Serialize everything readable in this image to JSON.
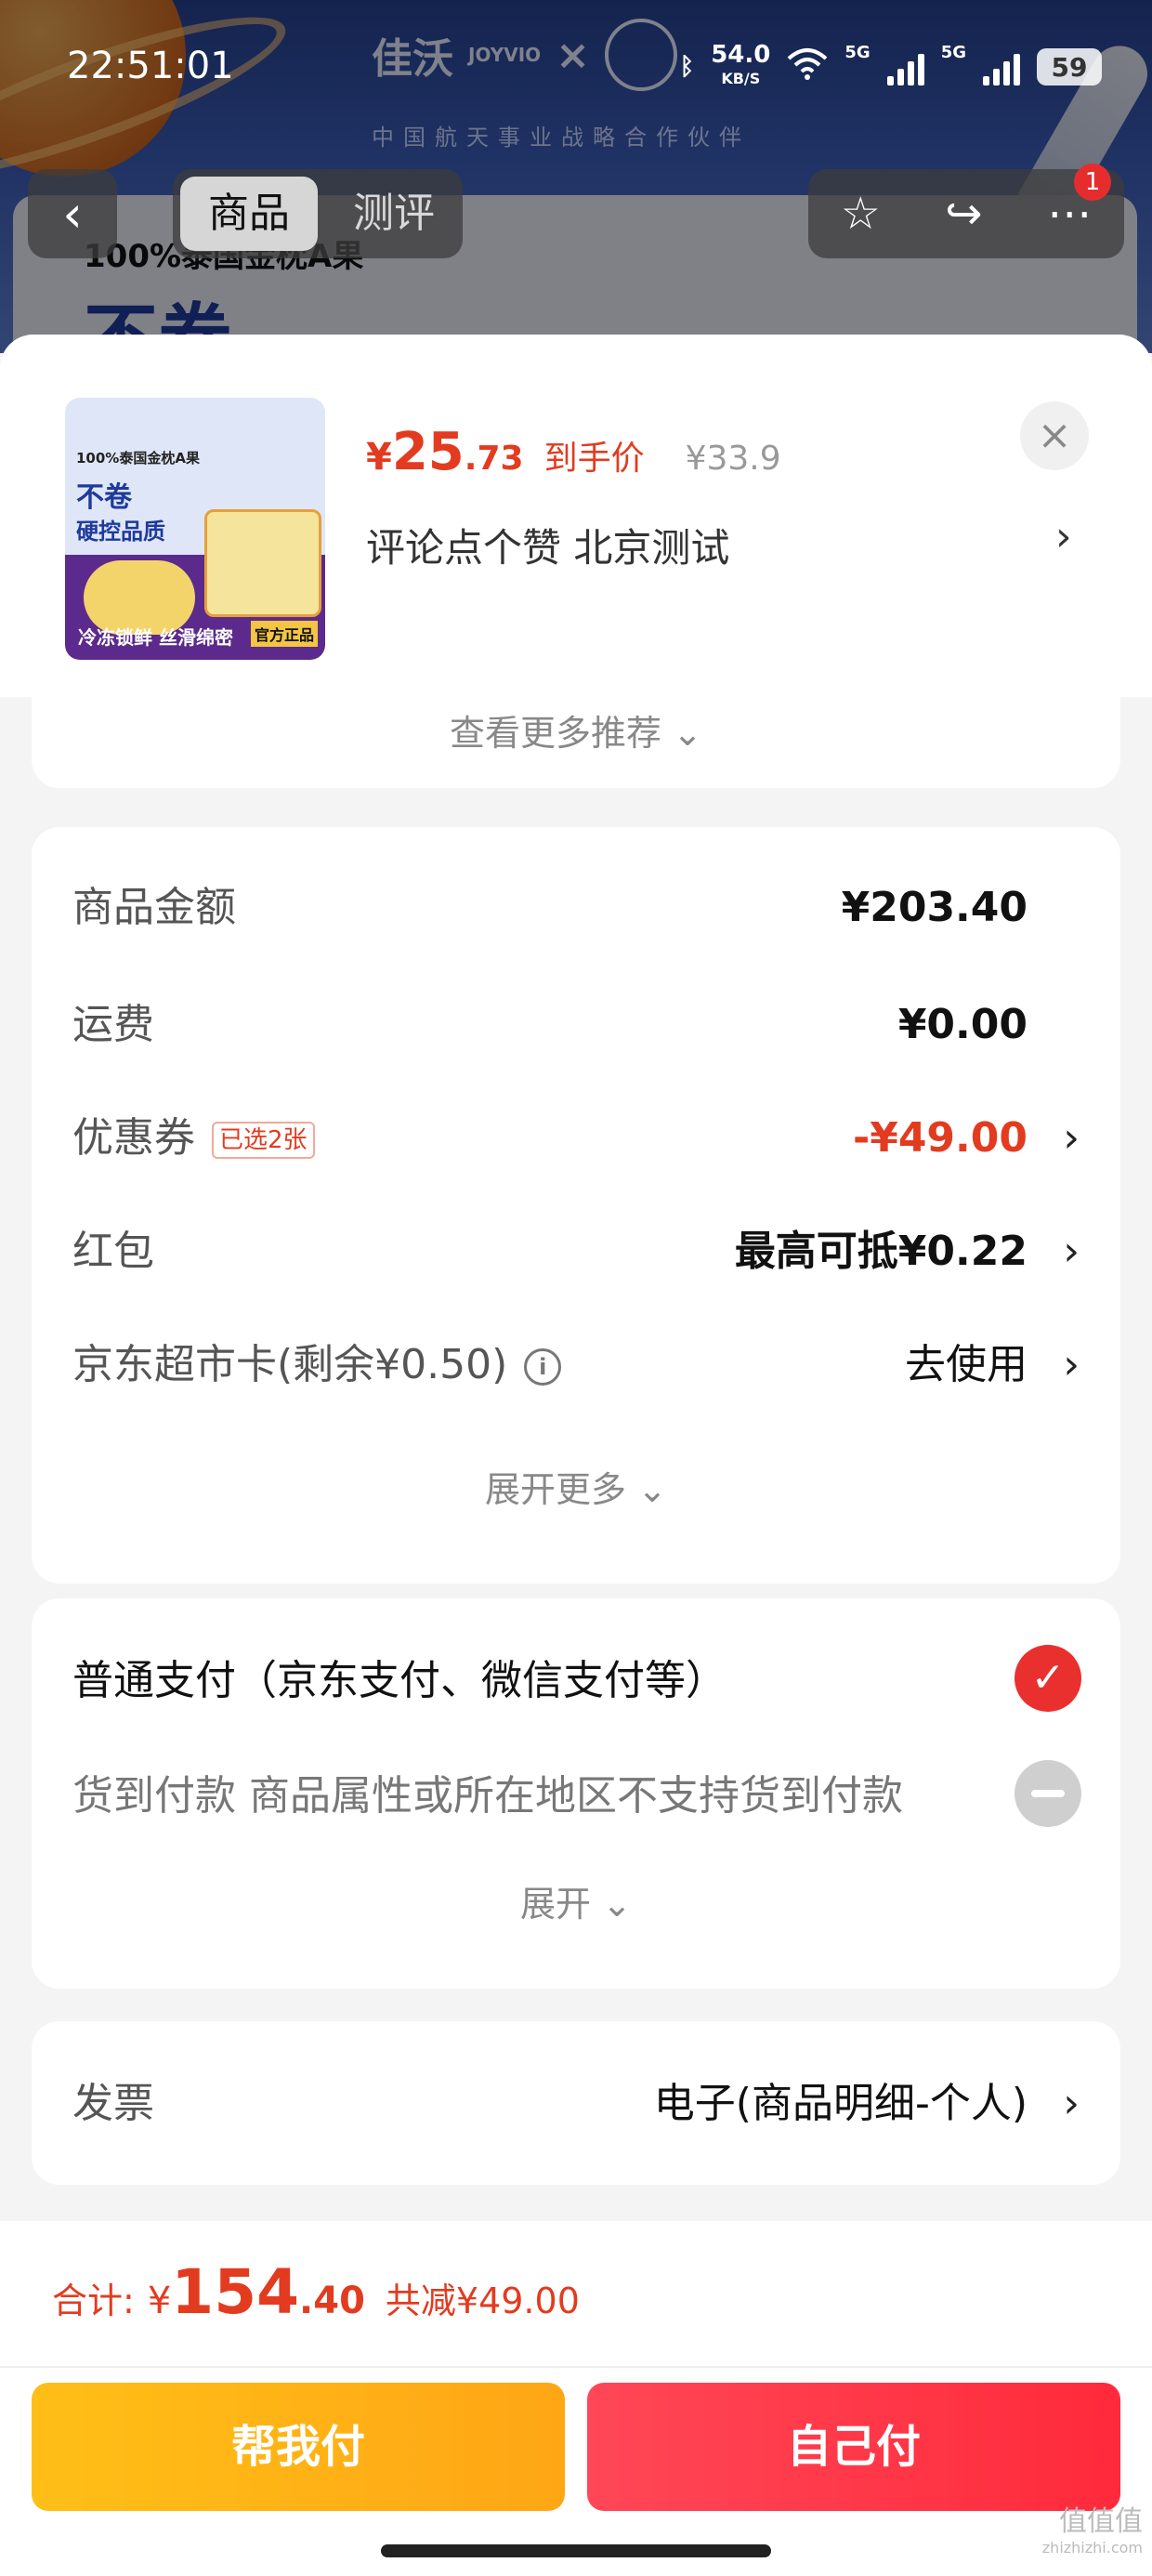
{
  "status_bar": {
    "time": "22:51:01",
    "net_speed": "54.0",
    "net_unit": "KB/S",
    "sim1": "5G",
    "sim2": "5G",
    "battery": "59"
  },
  "background": {
    "brand": "佳沃",
    "brand_en": "JOYVIO",
    "partner_sub": "中国航天事业战略合作伙伴",
    "banner_title": "100%泰国金枕A果",
    "banner_big": "不卷"
  },
  "nav": {
    "tabs": [
      "商品",
      "测评"
    ],
    "active_tab": 0,
    "notification_count": "1"
  },
  "product": {
    "thumb_texts": [
      "100%泰国金枕A果",
      "不卷",
      "硬控品质",
      "冷冻锁鲜 丝滑绵密",
      "官方正品"
    ],
    "price_currency": "¥",
    "price_int": "25",
    "price_dec": ".73",
    "price_label": "到手价",
    "original_price": "¥33.9",
    "review_text": "评论点个赞  北京测试"
  },
  "more_recommend": "查看更多推荐 ⌄",
  "summary": {
    "rows": [
      {
        "label": "商品金额",
        "value": "¥203.40"
      },
      {
        "label": "运费",
        "value": "¥0.00"
      },
      {
        "label": "优惠券",
        "tag": "已选2张",
        "value": "-¥49.00"
      },
      {
        "label": "红包",
        "value": "最高可抵¥0.22"
      },
      {
        "label": "京东超市卡(剩余¥0.50)",
        "value": "去使用"
      }
    ],
    "expand_label": "展开更多 ⌄"
  },
  "payment": {
    "normal_label": "普通支付（京东支付、微信支付等）",
    "cod_label": "货到付款  商品属性或所在地区不支持货到付款",
    "expand_label": "展开 ⌄"
  },
  "invoice": {
    "label": "发票",
    "value": "电子(商品明细-个人)"
  },
  "footer": {
    "total_label": "合计:",
    "total_currency": "¥",
    "total_int": "154",
    "total_dec": ".40",
    "saved": "共减¥49.00",
    "help_pay": "帮我付",
    "self_pay": "自己付"
  },
  "watermark": {
    "text": "值值值",
    "domain": "zhizhizhi.com"
  },
  "colors": {
    "accent_red": "#e33b1f",
    "check_red": "#ea2f2f",
    "help_btn": "#ffb316",
    "self_btn": "#ff3a4a"
  }
}
